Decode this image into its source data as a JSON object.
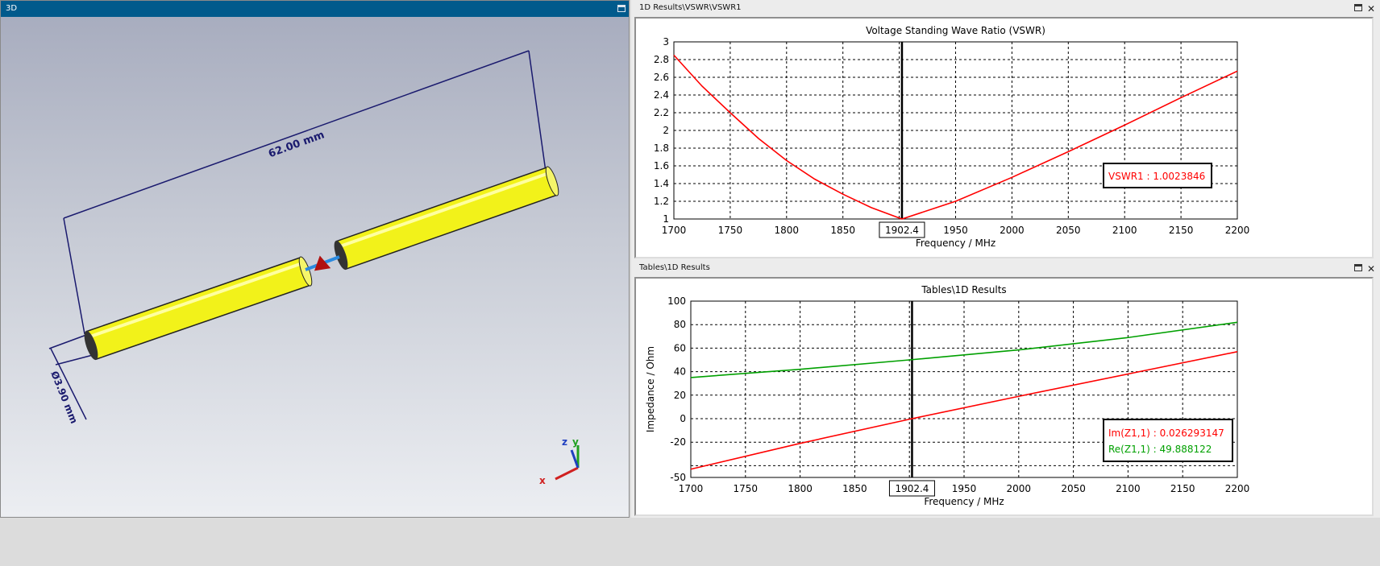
{
  "view3d": {
    "title": "3D",
    "dim_length": "62.00 mm",
    "dim_diameter": "Ø3.90 mm",
    "axes": {
      "x": "x",
      "y": "y",
      "z": "z"
    }
  },
  "top_panel": {
    "title": "1D Results\\VSWR\\VSWR1"
  },
  "bottom_panel": {
    "title": "Tables\\1D Results"
  },
  "colors": {
    "red": "#ff0000",
    "green": "#00a000",
    "titlebar_active": "#005a8c"
  },
  "chart_data": [
    {
      "type": "line",
      "title": "Voltage Standing Wave Ratio (VSWR)",
      "xlabel": "Frequency / MHz",
      "ylabel": "",
      "xlim": [
        1700,
        2200
      ],
      "ylim": [
        1,
        3
      ],
      "grid": true,
      "xticks": [
        "1700",
        "1750",
        "1800",
        "1850",
        "1950",
        "2000",
        "2050",
        "2100",
        "2150",
        "2200"
      ],
      "yticks": [
        "1",
        "1.2",
        "1.4",
        "1.6",
        "1.8",
        "2",
        "2.2",
        "2.4",
        "2.6",
        "2.8",
        "3"
      ],
      "marker": {
        "x": 1902.4,
        "label": "1902.4"
      },
      "series": [
        {
          "name": "VSWR1",
          "color": "#ff0000",
          "x": [
            1700,
            1725,
            1750,
            1775,
            1800,
            1825,
            1850,
            1875,
            1902.4,
            1950,
            2000,
            2050,
            2100,
            2150,
            2200
          ],
          "y": [
            2.85,
            2.5,
            2.2,
            1.91,
            1.66,
            1.45,
            1.28,
            1.13,
            1.0,
            1.2,
            1.47,
            1.76,
            2.06,
            2.37,
            2.67
          ]
        }
      ],
      "legend": [
        {
          "text": "VSWR1 : 1.0023846",
          "color": "#ff0000"
        }
      ],
      "legend_position": "right"
    },
    {
      "type": "line",
      "title": "Tables\\1D Results",
      "xlabel": "Frequency / MHz",
      "ylabel": "Impedance / Ohm",
      "xlim": [
        1700,
        2200
      ],
      "ylim": [
        -50,
        100
      ],
      "grid": true,
      "xticks": [
        "1700",
        "1750",
        "1800",
        "1850",
        "1950",
        "2000",
        "2050",
        "2100",
        "2150",
        "2200"
      ],
      "yticks": [
        "-50",
        "-20",
        "0",
        "20",
        "40",
        "60",
        "80",
        "100"
      ],
      "marker": {
        "x": 1902.4,
        "label": "1902.4"
      },
      "series": [
        {
          "name": "Im(Z1,1)",
          "color": "#ff0000",
          "x": [
            1700,
            1800,
            1902.4,
            2000,
            2100,
            2200
          ],
          "y": [
            -43,
            -21,
            0,
            19,
            38,
            57
          ]
        },
        {
          "name": "Re(Z1,1)",
          "color": "#00a000",
          "x": [
            1700,
            1800,
            1900,
            2000,
            2100,
            2200
          ],
          "y": [
            35,
            42,
            50,
            58.5,
            69,
            82
          ]
        }
      ],
      "legend": [
        {
          "text": "Im(Z1,1) : 0.026293147",
          "color": "#ff0000"
        },
        {
          "text": "Re(Z1,1) : 49.888122",
          "color": "#00a000"
        }
      ],
      "legend_position": "bottom-right"
    }
  ]
}
